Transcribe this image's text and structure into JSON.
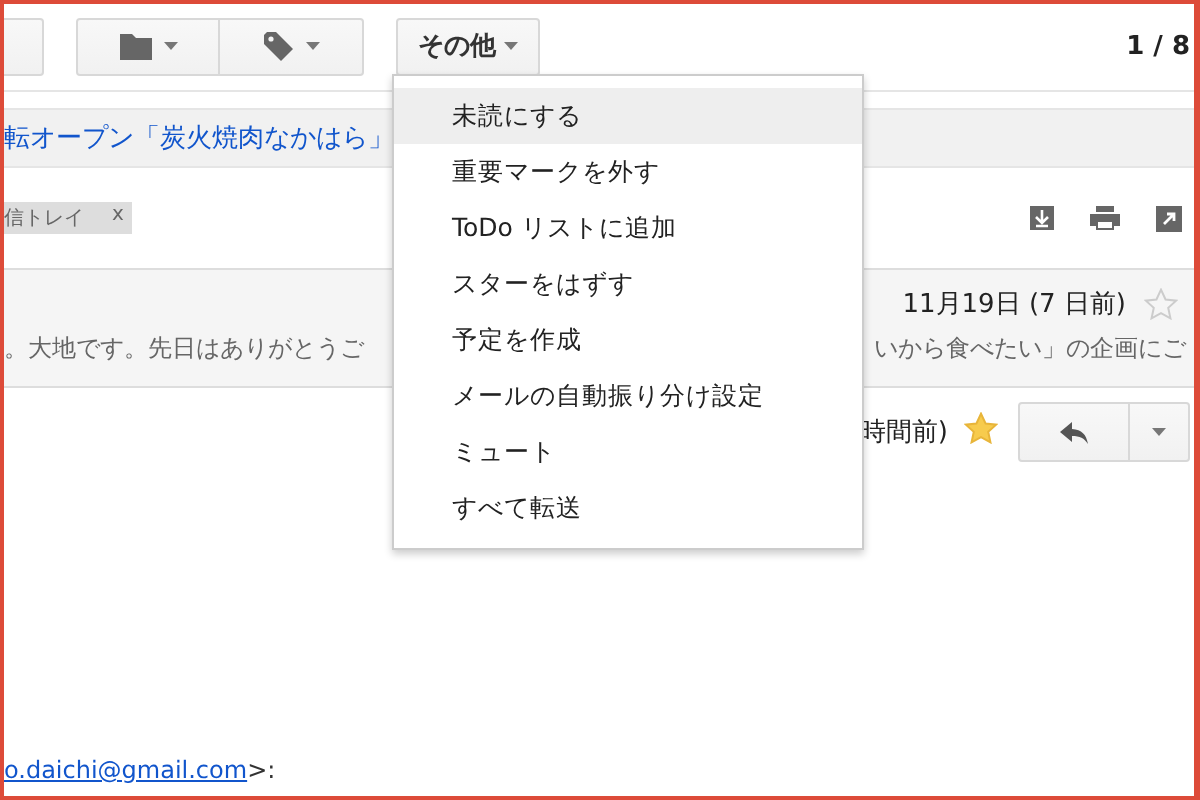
{
  "toolbar": {
    "more_button": {
      "label": "その他"
    },
    "pagination": "1 / 8"
  },
  "subject": "転オープン「炭火焼肉なかはら」",
  "labels": [
    {
      "label": "信トレイ",
      "remove": "x"
    }
  ],
  "messages": [
    {
      "date": "11月19日 (7 日前)",
      "starred": false,
      "snippet_start": "。大地です。先日はありがとうご",
      "snippet_end": "いから食べたい」の企画にご"
    },
    {
      "date": "時間前)",
      "starred": true
    }
  ],
  "sender_email": {
    "link": "o.daichi@gmail.com",
    "suffix": ">:"
  },
  "menu": [
    {
      "label": "未読にする",
      "selected": true
    },
    {
      "label": "重要マークを外す",
      "selected": false
    },
    {
      "label": "ToDo リストに追加",
      "selected": false
    },
    {
      "label": "スターをはずす",
      "selected": false
    },
    {
      "label": "予定を作成",
      "selected": false
    },
    {
      "label": "メールの自動振り分け設定",
      "selected": false
    },
    {
      "label": "ミュート",
      "selected": false
    },
    {
      "label": "すべて転送",
      "selected": false
    }
  ]
}
